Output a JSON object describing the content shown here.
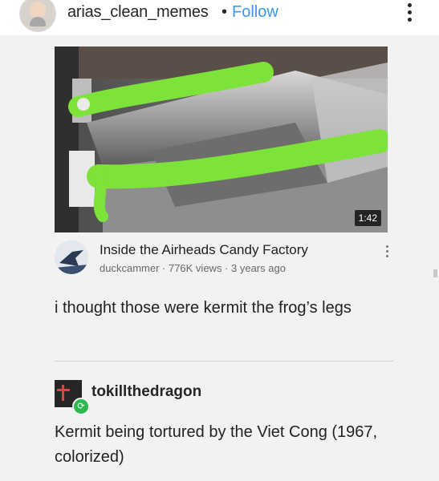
{
  "header": {
    "username": "arias_clean_memes",
    "separator": "•",
    "follow_label": "Follow"
  },
  "video": {
    "duration": "1:42",
    "title": "Inside the Airheads Candy Factory",
    "meta": "duckcammer · 776K views · 3 years ago"
  },
  "caption": "i thought those were kermit the frog’s legs",
  "reblog": {
    "username": "tokillthedragon",
    "text": "Kermit being tortured by the Viet Cong (1967, colorized)"
  },
  "colors": {
    "follow": "#3897f0",
    "candy_green": "#7de23a",
    "reblog_badge": "#2bba4e"
  }
}
